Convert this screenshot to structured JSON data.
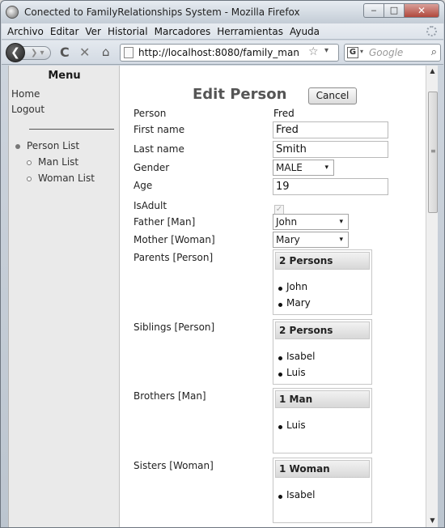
{
  "window": {
    "title": "Conected to FamilyRelationships System - Mozilla Firefox",
    "min": "‒",
    "max": "□",
    "close": "✕"
  },
  "menubar": {
    "items": [
      "Archivo",
      "Editar",
      "Ver",
      "Historial",
      "Marcadores",
      "Herramientas",
      "Ayuda"
    ]
  },
  "navbar": {
    "back": "❮",
    "forward": "❯ ▾",
    "reload": "C",
    "stop": "✕",
    "home": "⌂",
    "url": "http://localhost:8080/family_man",
    "star": "☆",
    "url_drop": "▾",
    "search_engine": "G",
    "search_drop": "▾",
    "search_placeholder": "Google",
    "search_icon": "⌕"
  },
  "sidebar": {
    "title": "Menu",
    "links": [
      "Home",
      "Logout"
    ],
    "items": [
      {
        "label": "Person List",
        "level": 0
      },
      {
        "label": "Man List",
        "level": 1
      },
      {
        "label": "Woman List",
        "level": 1
      }
    ]
  },
  "form": {
    "heading": "Edit Person",
    "cancel": "Cancel",
    "person_label": "Person",
    "person_value": "Fred",
    "first_name_label": "First name",
    "first_name": "Fred",
    "last_name_label": "Last name",
    "last_name": "Smith",
    "gender_label": "Gender",
    "gender": "MALE",
    "age_label": "Age",
    "age": "19",
    "isadult_label": "IsAdult",
    "isadult": true,
    "check_glyph": "✓",
    "father_label": "Father [Man]",
    "father": "John",
    "mother_label": "Mother [Woman]",
    "mother": "Mary",
    "caret": "▾",
    "parents_label": "Parents [Person]",
    "parents": {
      "header": "2 Persons",
      "items": [
        "John",
        "Mary"
      ]
    },
    "siblings_label": "Siblings [Person]",
    "siblings": {
      "header": "2 Persons",
      "items": [
        "Isabel",
        "Luis"
      ]
    },
    "brothers_label": "Brothers [Man]",
    "brothers": {
      "header": "1 Man",
      "items": [
        "Luis"
      ]
    },
    "sisters_label": "Sisters [Woman]",
    "sisters": {
      "header": "1 Woman",
      "items": [
        "Isabel"
      ]
    }
  },
  "scrollbar": {
    "up": "▲",
    "down": "▼",
    "grip": "≡"
  }
}
